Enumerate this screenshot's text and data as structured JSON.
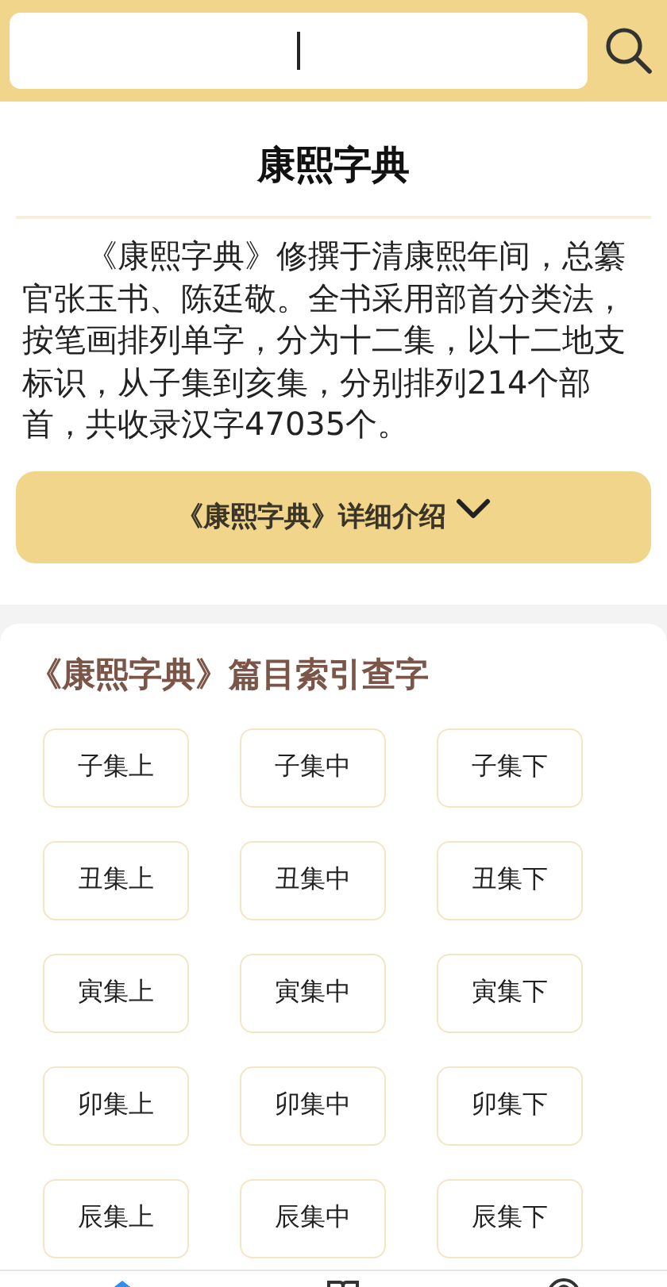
{
  "search": {
    "focused": true
  },
  "intro": {
    "title": "康熙字典",
    "text": "《康熙字典》修撰于清康熙年间，总纂官张玉书、陈廷敬。全书采用部首分类法，按笔画排列单字，分为十二集，以十二地支标识，从子集到亥集，分别排列214个部首，共收录汉字47035个。",
    "more_button": {
      "label": "《康熙字典》详细介绍",
      "expanded": false
    }
  },
  "index": {
    "heading": "《康熙字典》篇目索引查字",
    "volumes": [
      "子集上",
      "子集中",
      "子集下",
      "丑集上",
      "丑集中",
      "丑集下",
      "寅集上",
      "寅集中",
      "寅集下",
      "卯集上",
      "卯集中",
      "卯集下",
      "辰集上",
      "辰集中",
      "辰集下"
    ]
  },
  "nav_tabs": [
    {
      "selected": true
    },
    {
      "selected": false
    },
    {
      "selected": false
    }
  ]
}
